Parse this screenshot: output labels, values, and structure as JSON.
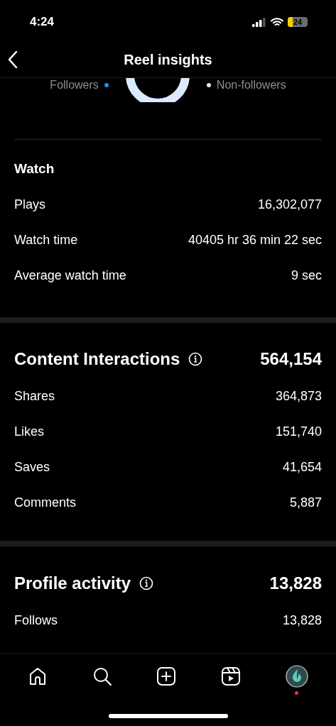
{
  "status_bar": {
    "time": "4:24",
    "battery": "24"
  },
  "header": {
    "title": "Reel insights"
  },
  "audience_legend": [
    {
      "label": "Followers",
      "color": "#1e90ff"
    },
    {
      "label": "Non-followers",
      "color": "#dbeafe"
    }
  ],
  "sections": [
    {
      "title": "Watch",
      "kind": "plain",
      "rows": [
        {
          "label": "Plays",
          "value": "16,302,077"
        },
        {
          "label": "Watch time",
          "value": "40405 hr 36 min 22 sec"
        },
        {
          "label": "Average watch time",
          "value": "9 sec"
        }
      ]
    },
    {
      "title": "Content Interactions",
      "kind": "total",
      "total": "564,154",
      "rows": [
        {
          "label": "Shares",
          "value": "364,873"
        },
        {
          "label": "Likes",
          "value": "151,740"
        },
        {
          "label": "Saves",
          "value": "41,654"
        },
        {
          "label": "Comments",
          "value": "5,887"
        }
      ]
    },
    {
      "title": "Profile activity",
      "kind": "total",
      "total": "13,828",
      "rows": [
        {
          "label": "Follows",
          "value": "13,828"
        }
      ]
    }
  ],
  "tab_bar": {
    "profile_notification": true
  }
}
